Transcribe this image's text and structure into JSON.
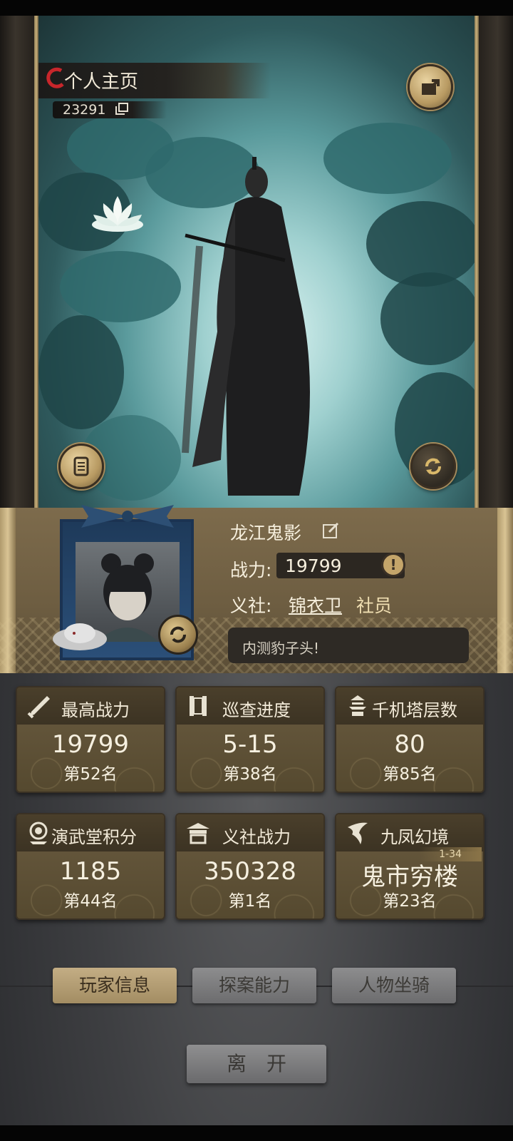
{
  "header": {
    "title": "个人主页",
    "player_id": "23291"
  },
  "profile": {
    "name": "龙江鬼影",
    "power_label": "战力:",
    "power_value": "19799",
    "guild_label": "义社:",
    "guild_name": "锦衣卫",
    "guild_role": "社员",
    "signature": "内测豹子头!"
  },
  "stats": [
    {
      "title": "最高战力",
      "value": "19799",
      "rank": "第52名",
      "icon": "sword-icon"
    },
    {
      "title": "巡查进度",
      "value": "5-15",
      "rank": "第38名",
      "icon": "scroll-icon"
    },
    {
      "title": "千机塔层数",
      "value": "80",
      "rank": "第85名",
      "icon": "pagoda-icon"
    },
    {
      "title": "演武堂积分",
      "value": "1185",
      "rank": "第44名",
      "icon": "medal-icon"
    },
    {
      "title": "义社战力",
      "value": "350328",
      "rank": "第1名",
      "icon": "hall-icon"
    },
    {
      "title": "九凤幻境",
      "value": "鬼市穷楼",
      "rank": "第23名",
      "tag": "1-34",
      "icon": "phoenix-icon"
    }
  ],
  "tabs": [
    {
      "label": "玩家信息",
      "active": true
    },
    {
      "label": "探案能力",
      "active": false
    },
    {
      "label": "人物坐骑",
      "active": false
    }
  ],
  "leave_button": "离开",
  "colors": {
    "gold": "#c4a56a",
    "panel_brown": "#6d5d41",
    "card_brown": "#55492f",
    "tab_active": "#b39c72",
    "tab_inactive": "#7b7b7d"
  }
}
